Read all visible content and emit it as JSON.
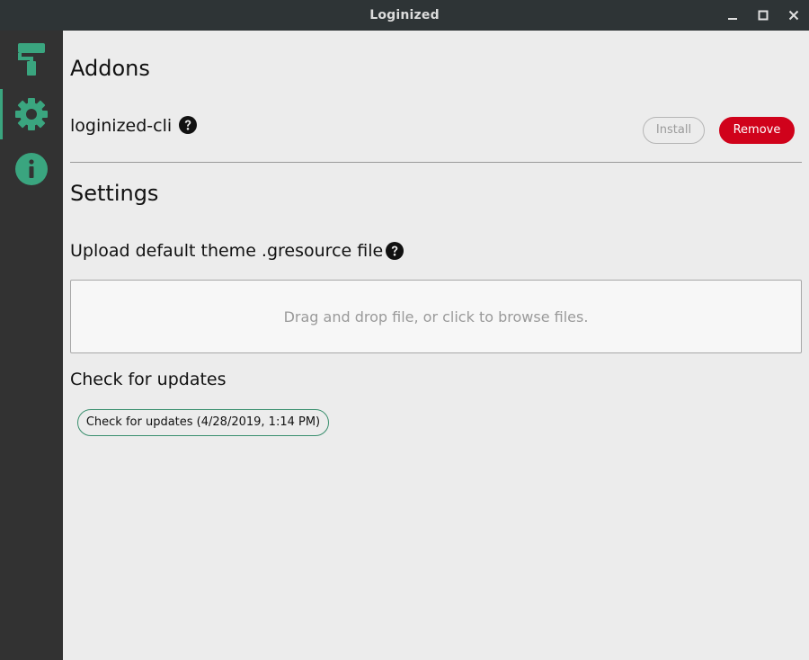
{
  "window": {
    "title": "Loginized",
    "controls": {
      "minimize_icon": "minimize-icon",
      "maximize_icon": "maximize-icon",
      "close_icon": "close-icon"
    }
  },
  "sidebar": {
    "accent": "#3aa57f",
    "items": [
      {
        "icon": "paint-roller-icon",
        "active": false
      },
      {
        "icon": "gear-icon",
        "active": true
      },
      {
        "icon": "info-icon",
        "active": false
      }
    ]
  },
  "addons": {
    "heading": "Addons",
    "items": [
      {
        "name": "loginized-cli",
        "help_icon": "question-circle-icon",
        "install_label": "Install",
        "remove_label": "Remove"
      }
    ]
  },
  "settings": {
    "heading": "Settings",
    "upload": {
      "label": "Upload default theme .gresource file",
      "help_icon": "question-circle-icon",
      "dropzone_text": "Drag and drop file, or click to browse files."
    },
    "updates": {
      "label": "Check for updates",
      "button_label": "Check for updates (4/28/2019, 1:14 PM)"
    }
  },
  "colors": {
    "remove_button": "#d0021b",
    "accent_green": "#3aa57f",
    "titlebar": "#2e3436",
    "sidebar": "#323232"
  }
}
